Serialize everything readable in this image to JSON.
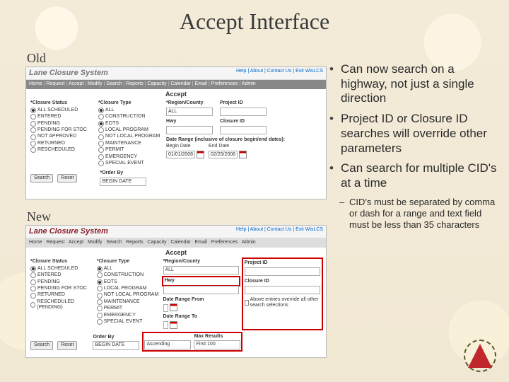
{
  "title": "Accept Interface",
  "labels": {
    "old": "Old",
    "new": "New"
  },
  "lcs_title": "Lane Closure System",
  "toplinks": [
    "Help",
    "About",
    "Contact Us",
    "Exit WisLCS"
  ],
  "menubar": [
    "Home",
    "Request",
    "Accept",
    "Modify",
    "Search",
    "Reports",
    "Capacity",
    "Calendar",
    "Email",
    "Preferences",
    "Admin"
  ],
  "subtitle": "Accept",
  "closure_status": {
    "header": "*Closure Status",
    "items": [
      "ALL SCHEDULED",
      "ENTERED",
      "PENDING",
      "PENDING FOR STOC",
      "NOT APPROVED",
      "RETURNED",
      "RESCHEDULED"
    ],
    "items_new": [
      "ALL SCHEDULED",
      "ENTERED",
      "PENDING",
      "PENDING FOR STOC",
      "RETURNED",
      "RESCHEDULED (PENDING)"
    ]
  },
  "closure_type": {
    "header": "*Closure Type",
    "items": [
      "ALL",
      "CONSTRUCTION",
      "EOTS",
      "LOCAL PROGRAM",
      "NOT LOCAL PROGRAM",
      "MAINTENANCE",
      "PERMIT",
      "EMERGENCY",
      "SPECIAL EVENT"
    ]
  },
  "old_right": {
    "region_label": "*Region/County",
    "region_value": "ALL",
    "project_id_label": "Project ID",
    "hwy_label": "Hwy",
    "closure_id_label": "Closure ID",
    "daterange_label": "Date Range (inclusive of closure begin/end dates):",
    "begin_label": "Begin Date",
    "end_label": "End Date",
    "begin_val": "01/01/2008",
    "end_val": "02/25/2008"
  },
  "new_right": {
    "region_label": "*Region/County",
    "region_value": "ALL",
    "project_id_label": "Project ID",
    "hwy_label": "Hwy",
    "closure_id_label": "Closure ID",
    "dr_from": "Date Range From",
    "dr_to": "Date Range To",
    "override_label": "Above entries override all other search selections"
  },
  "footer_old": {
    "search": "Search",
    "reset": "Reset",
    "orderby_label": "*Order By",
    "orderby_value": "BEGIN DATE"
  },
  "footer_new": {
    "search": "Search",
    "reset": "Reset",
    "orderby_label": "Order By",
    "orderby_value": "BEGIN DATE",
    "sort_value": "Ascending",
    "max_label": "Max Results",
    "max_value": "First 100"
  },
  "bullets": [
    "Can now search on a highway, not just a single direction",
    "Project ID or Closure ID searches will override other parameters",
    "Can search for multiple CID's at a time"
  ],
  "subbullet": "CID's must be separated by comma or dash for a range and text field must be less than 35 characters"
}
